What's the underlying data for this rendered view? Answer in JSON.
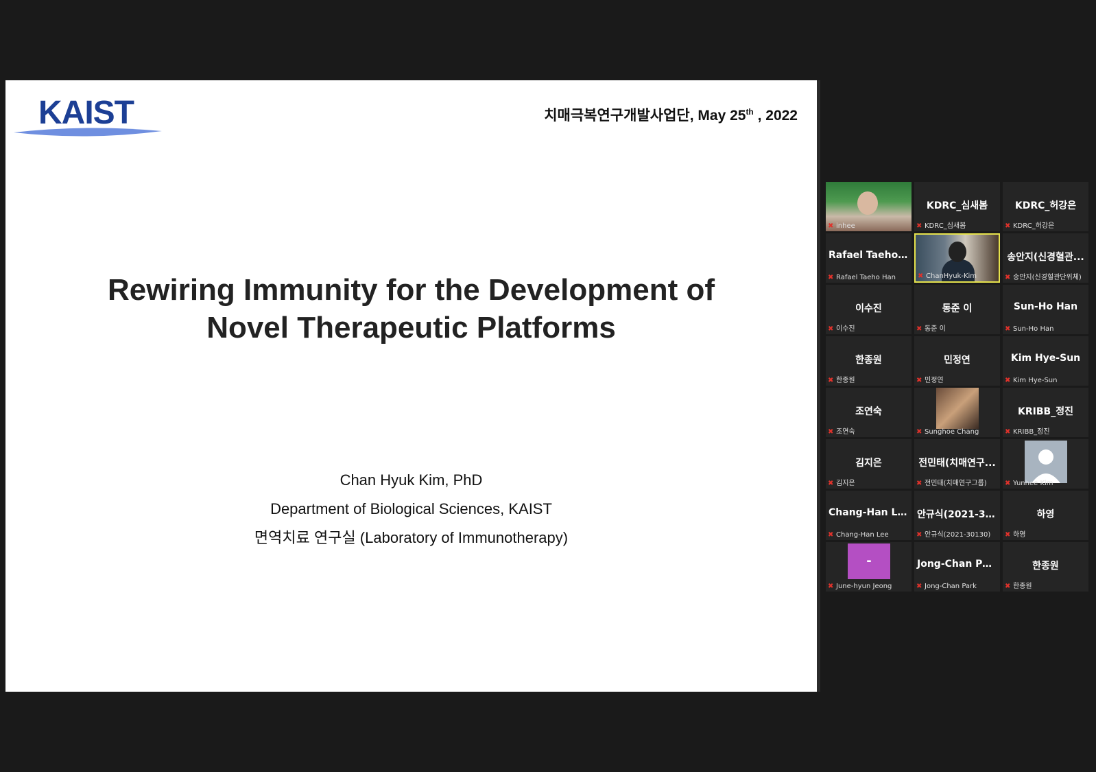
{
  "slide": {
    "logo_text": "KAIST",
    "header_prefix": "치매극복연구개발사업단, May 25",
    "header_sup": "th",
    "header_suffix": " , 2022",
    "title_line1": "Rewiring Immunity for the Development of",
    "title_line2": "Novel Therapeutic Platforms",
    "presenter_name": "Chan Hyuk Kim, PhD",
    "presenter_dept": "Department of Biological Sciences, KAIST",
    "presenter_lab": "면역치료 연구실 (Laboratory of Immunotherapy)"
  },
  "participants": [
    {
      "display": "",
      "label": "inhee",
      "video": true
    },
    {
      "display": "KDRC_심새봄",
      "label": "KDRC_심새봄"
    },
    {
      "display": "KDRC_허강은",
      "label": "KDRC_허강은"
    },
    {
      "display": "Rafael Taeho Han",
      "label": "Rafael Taeho Han"
    },
    {
      "display": "",
      "label": "ChanHyuk-Kim",
      "video": true,
      "active": true
    },
    {
      "display": "송안지(신경혈관...",
      "label": "송안지(신경혈관단위체)"
    },
    {
      "display": "이수진",
      "label": "이수진"
    },
    {
      "display": "동준 이",
      "label": "동준 이"
    },
    {
      "display": "Sun-Ho Han",
      "label": "Sun-Ho Han"
    },
    {
      "display": "한종원",
      "label": "한종원"
    },
    {
      "display": "민정연",
      "label": "민정연"
    },
    {
      "display": "Kim Hye-Sun",
      "label": "Kim Hye-Sun"
    },
    {
      "display": "조연숙",
      "label": "조연숙"
    },
    {
      "display": "",
      "label": "Sunghoe Chang",
      "photo": true
    },
    {
      "display": "KRIBB_정진",
      "label": "KRIBB_정진"
    },
    {
      "display": "김지은",
      "label": "김지은"
    },
    {
      "display": "전민태(치매연구...",
      "label": "전민태(치매연구그룹)"
    },
    {
      "display": "",
      "label": "Yunhee Kim",
      "avatar": true
    },
    {
      "display": "Chang-Han Lee",
      "label": "Chang-Han Lee"
    },
    {
      "display": "안규식(2021-30...",
      "label": "안규식(2021-30130)"
    },
    {
      "display": "하영",
      "label": "하영"
    },
    {
      "display": "",
      "label": "June-hyun Jeong",
      "purple": true,
      "purple_text": "-"
    },
    {
      "display": "Jong-Chan Park",
      "label": "Jong-Chan Park"
    },
    {
      "display": "한종원",
      "label": "한종원"
    }
  ],
  "colors": {
    "background": "#1a1a1a",
    "tile": "#252525",
    "active_border": "#e6e24c",
    "mic_muted": "#e0322b",
    "kaist_blue": "#1c3f95",
    "purple_avatar": "#b44fc3"
  }
}
